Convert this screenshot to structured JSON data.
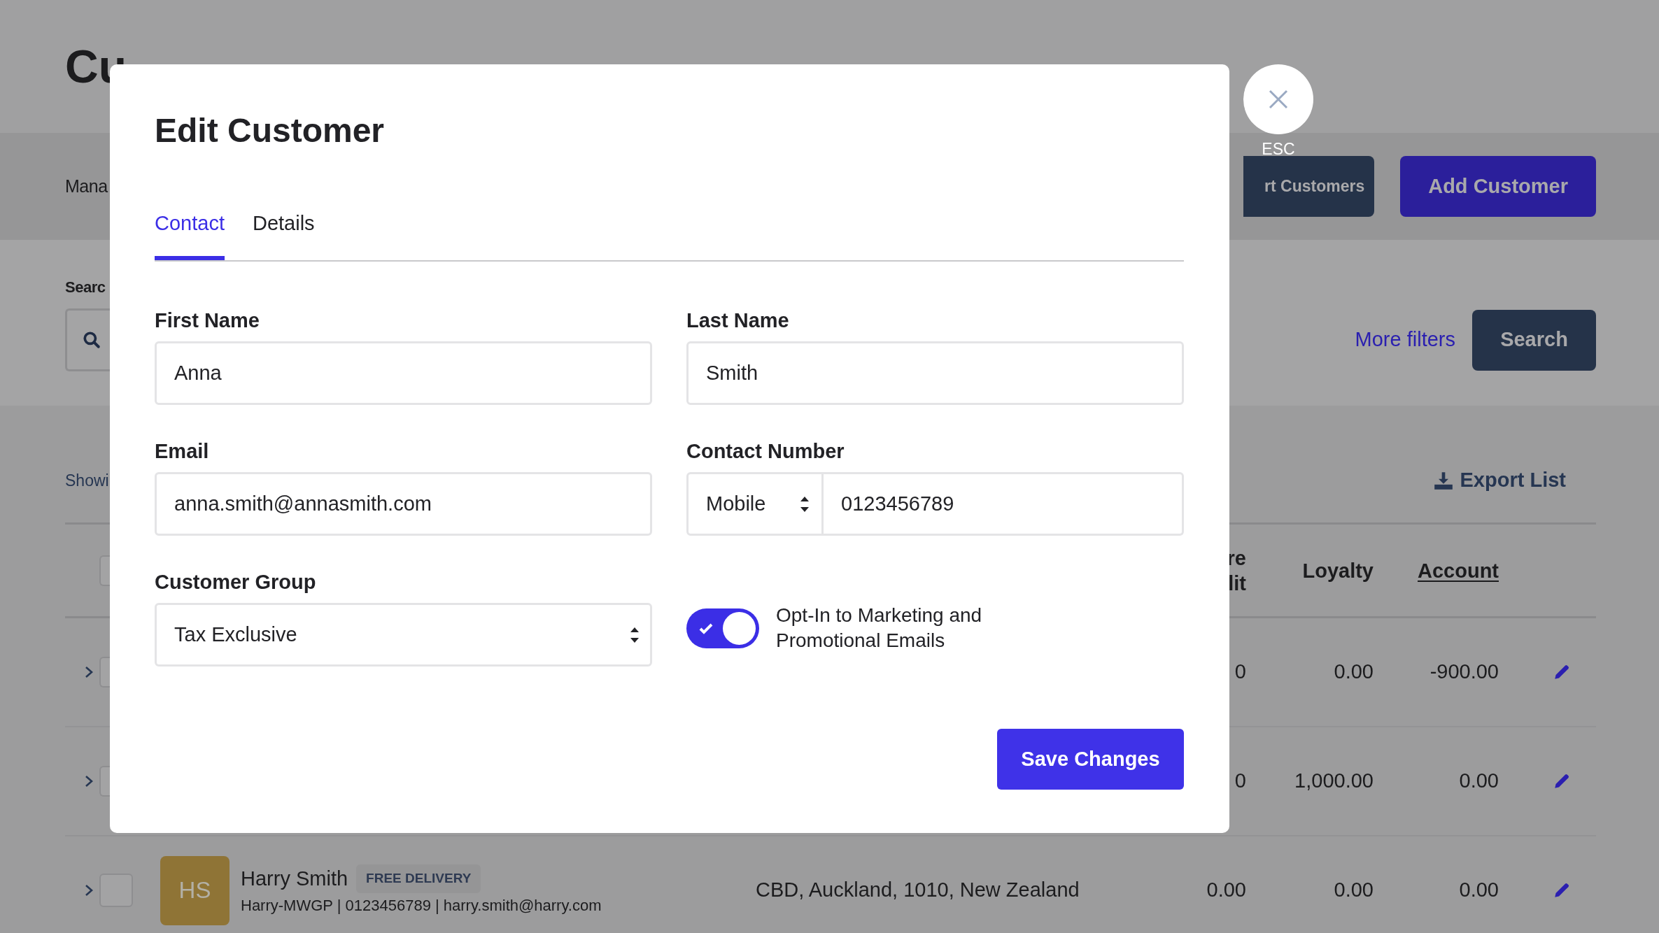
{
  "page": {
    "title": "Cu",
    "subtitle": "Mana",
    "actions": [
      {
        "label": "rt Customers",
        "kind": "secondary"
      },
      {
        "label": "Add Customer",
        "kind": "primary"
      }
    ]
  },
  "search": {
    "label": "Searc",
    "more_filters": "More filters",
    "button": "Search"
  },
  "list": {
    "showing": "Showi",
    "export": "Export List",
    "select_all": {
      "checked": false
    },
    "columns": [
      {
        "lines": [
          "re",
          "lit"
        ],
        "underlined": false
      },
      {
        "lines": [
          "Loyalty"
        ],
        "underlined": false
      },
      {
        "lines": [
          "Account"
        ],
        "underlined": true
      }
    ],
    "rows": [
      {
        "checked": false,
        "store_credit": "0",
        "loyalty": "0.00",
        "account": "-900.00"
      },
      {
        "checked": false,
        "store_credit": "0",
        "loyalty": "1,000.00",
        "account": "0.00"
      },
      {
        "checked": false,
        "initials": "HS",
        "name": "Harry Smith",
        "tag": "FREE DELIVERY",
        "details": "Harry-MWGP | 0123456789 | harry.smith@harry.com",
        "address": "CBD, Auckland, 1010, New Zealand",
        "store_credit": "0.00",
        "loyalty": "0.00",
        "account": "0.00"
      }
    ]
  },
  "modal": {
    "title": "Edit Customer",
    "close_hint": "ESC",
    "tabs": [
      {
        "label": "Contact",
        "selected": true
      },
      {
        "label": "Details",
        "selected": false
      }
    ],
    "fields": [
      {
        "kind": "text",
        "label": "First Name",
        "value": "Anna"
      },
      {
        "kind": "text",
        "label": "Last Name",
        "value": "Smith"
      },
      {
        "kind": "text",
        "label": "Email",
        "value": "anna.smith@annasmith.com"
      },
      {
        "kind": "phone",
        "label": "Contact Number",
        "type": "Mobile",
        "value": "0123456789"
      },
      {
        "kind": "select",
        "label": "Customer Group",
        "value": "Tax Exclusive"
      },
      {
        "kind": "toggle",
        "label": "Opt-In to Marketing and Promotional Emails",
        "on": true
      }
    ],
    "save": "Save Changes"
  }
}
